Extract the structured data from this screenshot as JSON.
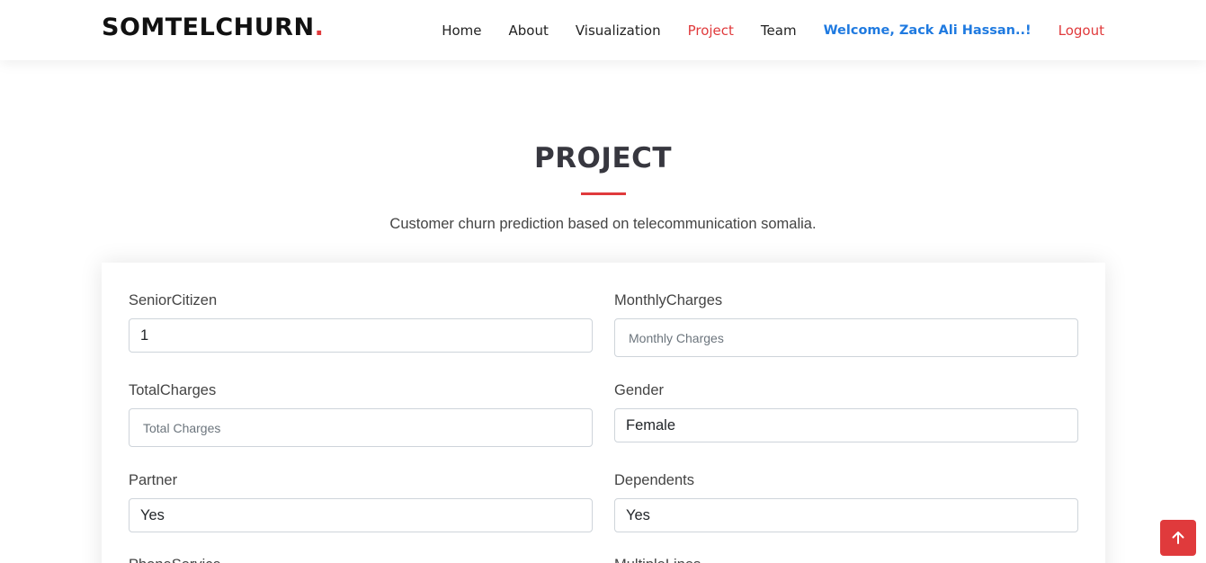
{
  "header": {
    "logo_text": "SOMTELCHURN",
    "logo_dot": ".",
    "nav": {
      "home": "Home",
      "about": "About",
      "visualization": "Visualization",
      "project": "Project",
      "team": "Team",
      "welcome": "Welcome, Zack Ali Hassan..!",
      "logout": "Logout"
    }
  },
  "section": {
    "title": "PROJECT",
    "subtitle": "Customer churn prediction based on telecommunication somalia."
  },
  "form": {
    "senior_citizen": {
      "label": "SeniorCitizen",
      "value": "1"
    },
    "monthly_charges": {
      "label": "MonthlyCharges",
      "placeholder": "Monthly Charges"
    },
    "total_charges": {
      "label": "TotalCharges",
      "placeholder": "Total Charges"
    },
    "gender": {
      "label": "Gender",
      "value": "Female"
    },
    "partner": {
      "label": "Partner",
      "value": "Yes"
    },
    "dependents": {
      "label": "Dependents",
      "value": "Yes"
    },
    "phone_service": {
      "label": "PhoneService"
    },
    "multiple_lines": {
      "label": "MultipleLines"
    }
  },
  "colors": {
    "accent": "#e03a3c",
    "welcome": "#1f7ae0"
  },
  "icons": {
    "back_to_top": "arrow-up-icon"
  }
}
